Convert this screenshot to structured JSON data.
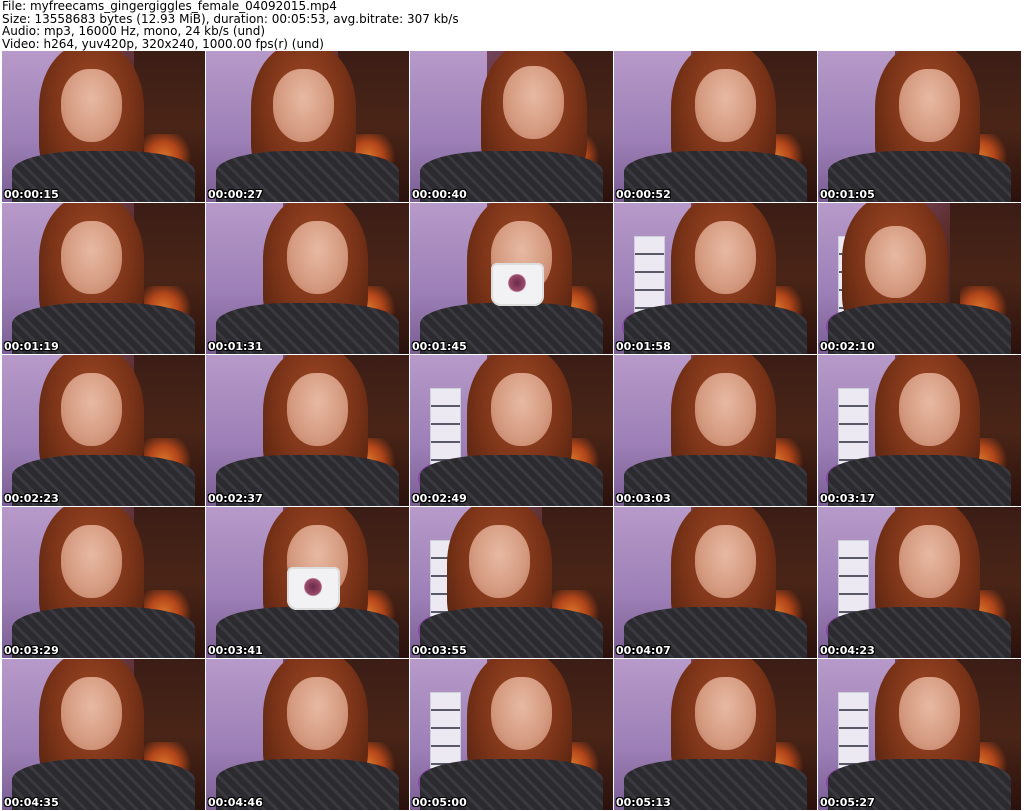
{
  "header": {
    "file_line": "File: myfreecams_gingergiggles_female_04092015.mp4",
    "size_line": "Size: 13558683 bytes (12.93 MiB), duration: 00:05:53, avg.bitrate: 307 kb/s",
    "audio_line": "Audio: mp3, 16000 Hz, mono, 24 kb/s (und)",
    "video_line": "Video: h264, yuv420p, 320x240, 1000.00 fps(r) (und)"
  },
  "thumbnails": [
    {
      "timestamp": "00:00:15",
      "variant": "v1",
      "scene": "plain"
    },
    {
      "timestamp": "00:00:27",
      "variant": "v0",
      "scene": "plain"
    },
    {
      "timestamp": "00:00:40",
      "variant": "v3",
      "scene": "plain"
    },
    {
      "timestamp": "00:00:52",
      "variant": "v2",
      "scene": "plain"
    },
    {
      "timestamp": "00:01:05",
      "variant": "v2",
      "scene": "plain"
    },
    {
      "timestamp": "00:01:19",
      "variant": "v1",
      "scene": "plain"
    },
    {
      "timestamp": "00:01:31",
      "variant": "v2",
      "scene": "plain"
    },
    {
      "timestamp": "00:01:45",
      "variant": "v2",
      "scene": "cup"
    },
    {
      "timestamp": "00:01:58",
      "variant": "v2",
      "scene": "shelf"
    },
    {
      "timestamp": "00:02:10",
      "variant": "v4",
      "scene": "shelf"
    },
    {
      "timestamp": "00:02:23",
      "variant": "v1",
      "scene": "plain"
    },
    {
      "timestamp": "00:02:37",
      "variant": "v2",
      "scene": "plain"
    },
    {
      "timestamp": "00:02:49",
      "variant": "v2",
      "scene": "shelf"
    },
    {
      "timestamp": "00:03:03",
      "variant": "v2",
      "scene": "plain"
    },
    {
      "timestamp": "00:03:17",
      "variant": "v2",
      "scene": "shelf"
    },
    {
      "timestamp": "00:03:29",
      "variant": "v1",
      "scene": "plain"
    },
    {
      "timestamp": "00:03:41",
      "variant": "v2",
      "scene": "cup"
    },
    {
      "timestamp": "00:03:55",
      "variant": "v1",
      "scene": "shelf"
    },
    {
      "timestamp": "00:04:07",
      "variant": "v2",
      "scene": "plain"
    },
    {
      "timestamp": "00:04:23",
      "variant": "v2",
      "scene": "shelf"
    },
    {
      "timestamp": "00:04:35",
      "variant": "v1",
      "scene": "plain"
    },
    {
      "timestamp": "00:04:46",
      "variant": "v2",
      "scene": "plain"
    },
    {
      "timestamp": "00:05:00",
      "variant": "v2",
      "scene": "shelf"
    },
    {
      "timestamp": "00:05:13",
      "variant": "v2",
      "scene": "plain"
    },
    {
      "timestamp": "00:05:27",
      "variant": "v2",
      "scene": "shelf"
    }
  ]
}
